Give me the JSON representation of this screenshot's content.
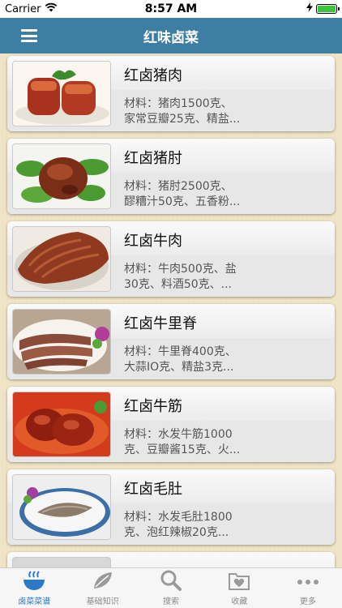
{
  "status_bar": {
    "carrier": "Carrier",
    "time": "8:57 AM"
  },
  "nav": {
    "title": "红味卤菜"
  },
  "recipes": [
    {
      "title": "红卤猪肉",
      "desc_line1": "材料：猪肉1500克、",
      "desc_line2": "家常豆瓣25克、精盐..."
    },
    {
      "title": "红卤猪肘",
      "desc_line1": "材料：猪肘2500克、",
      "desc_line2": "醪糟汁50克、五香粉..."
    },
    {
      "title": "红卤牛肉",
      "desc_line1": "材料：牛肉500克、盐",
      "desc_line2": "30克、料酒50克、..."
    },
    {
      "title": "红卤牛里脊",
      "desc_line1": "材料：牛里脊400克、",
      "desc_line2": "大蒜IO克、精盐3克..."
    },
    {
      "title": "红卤牛筋",
      "desc_line1": "材料：水发牛筋1000",
      "desc_line2": "克、豆瓣酱15克、火..."
    },
    {
      "title": "红卤毛肚",
      "desc_line1": "材料：水发毛肚1800",
      "desc_line2": "克、泡红辣椒20克..."
    }
  ],
  "tabs": [
    {
      "label": "卤菜菜谱",
      "icon": "bowl-icon",
      "active": true
    },
    {
      "label": "基础知识",
      "icon": "leaf-icon",
      "active": false
    },
    {
      "label": "搜索",
      "icon": "search-icon",
      "active": false
    },
    {
      "label": "收藏",
      "icon": "heart-folder-icon",
      "active": false
    },
    {
      "label": "更多",
      "icon": "more-dots-icon",
      "active": false
    }
  ],
  "colors": {
    "nav": "#3f7ea3",
    "background": "#efe3c4",
    "tab_active": "#2c79c6",
    "battery": "#3cc43c"
  }
}
